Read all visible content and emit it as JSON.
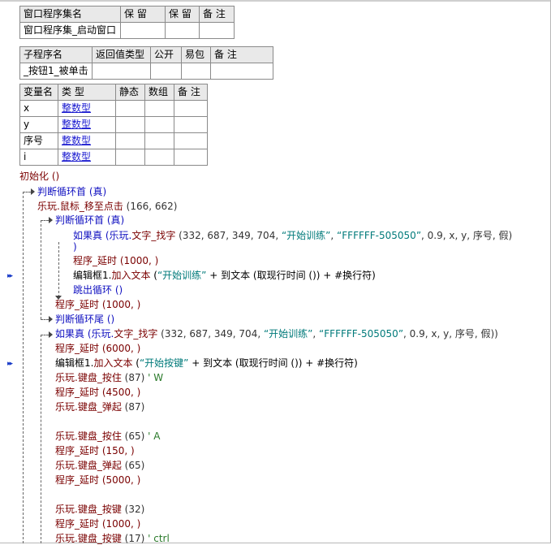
{
  "window_table": {
    "headers": [
      "窗口程序集名",
      "保 留",
      "保 留",
      "备 注"
    ],
    "row": [
      "窗口程序集_启动窗口",
      "",
      "",
      ""
    ]
  },
  "sub_table": {
    "headers": [
      "子程序名",
      "返回值类型",
      "公开",
      "易包",
      "备 注"
    ],
    "row": [
      "_按钮1_被单击",
      "",
      "",
      "",
      ""
    ]
  },
  "var_table": {
    "headers": [
      "变量名",
      "类 型",
      "静态",
      "数组",
      "备 注"
    ],
    "rows": [
      {
        "name": "x",
        "type": "整数型"
      },
      {
        "name": "y",
        "type": "整数型"
      },
      {
        "name": "序号",
        "type": "整数型"
      },
      {
        "name": "i",
        "type": "整数型"
      }
    ]
  },
  "code": {
    "l0": "初始化 ()",
    "l1": "判断循环首 (真)",
    "l2a": "乐玩.",
    "l2b": "鼠标_移至点击",
    "l2c": " (166, 662)",
    "l3": "判断循环首 (真)",
    "l4a": "如果真 (乐玩.",
    "l4b": "文字_找字",
    "l4c": " (332, 687, 349, 704, ",
    "l4s1": "“开始训练”",
    "l4d": ", ",
    "l4s2": "“FFFFFF-505050”",
    "l4e": ", 0.9, x, y, 序号, 假)",
    "l4f": ")",
    "l5": "程序_延时 (1000, )",
    "l6a": "编辑框1.",
    "l6b": "加入文本",
    "l6c": " (",
    "l6s": "“开始训练”",
    "l6d": " + 到文本 (取现行时间 ()) + #换行符)",
    "l7": "跳出循环 ()",
    "l8": "程序_延时 (1000, )",
    "l9": "判断循环尾 ()",
    "l10a": "如果真 (乐玩.",
    "l10b": "文字_找字",
    "l10c": " (332, 687, 349, 704, ",
    "l10s1": "“开始训练”",
    "l10d": ", ",
    "l10s2": "“FFFFFF-505050”",
    "l10e": ", 0.9, x, y, 序号, 假))",
    "l11": "程序_延时 (6000, )",
    "l12a": "编辑框1.",
    "l12b": "加入文本",
    "l12c": " (",
    "l12s": "“开始按键”",
    "l12d": " + 到文本 (取现行时间 ()) + #换行符)",
    "l13a": "乐玩.",
    "l13b": "键盘_按住",
    "l13c": " (87)",
    "l13m": " ' W",
    "l14": "程序_延时 (4500, )",
    "l15a": "乐玩.",
    "l15b": "键盘_弹起",
    "l15c": " (87)",
    "l16a": "乐玩.",
    "l16b": "键盘_按住",
    "l16c": " (65)",
    "l16m": " ' A",
    "l17": "程序_延时 (150, )",
    "l18a": "乐玩.",
    "l18b": "键盘_弹起",
    "l18c": " (65)",
    "l19": "程序_延时 (5000, )",
    "l20a": "乐玩.",
    "l20b": "键盘_按键",
    "l20c": " (32)",
    "l21": "程序_延时 (1000, )",
    "l22a": "乐玩.",
    "l22b": "键盘_按键",
    "l22c": " (17)",
    "l22m": " ' ctrl"
  },
  "gutter": {
    "marker1": "▸▸",
    "marker2": "▸▸"
  }
}
